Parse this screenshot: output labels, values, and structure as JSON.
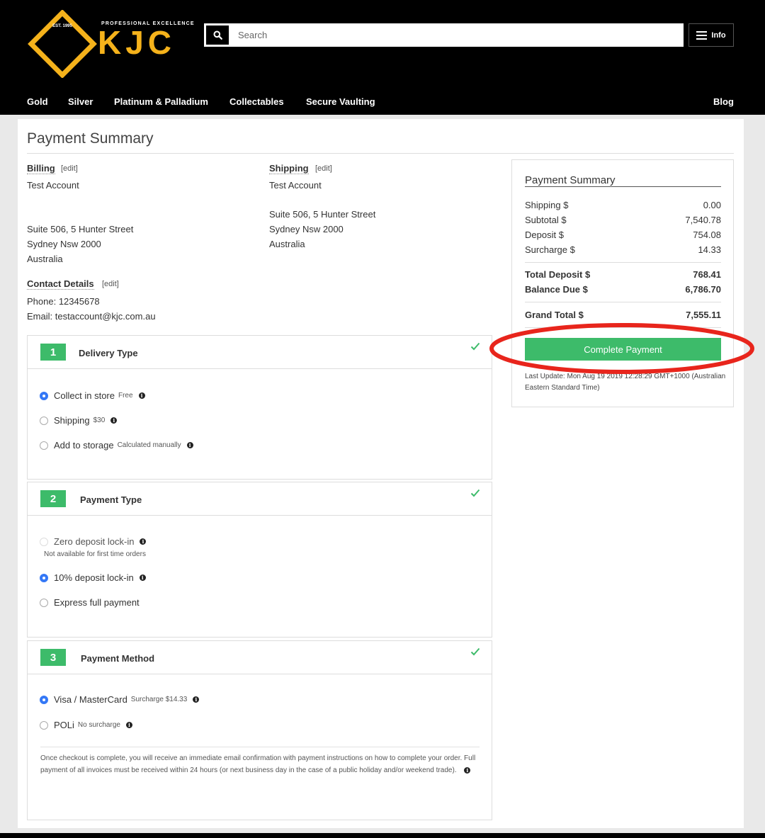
{
  "brand": {
    "name": "KJC",
    "tagline": "PROFESSIONAL EXCELLENCE",
    "est": "EST. 1995",
    "accent_color": "#f5b21b"
  },
  "search": {
    "placeholder": "Search"
  },
  "info_button": {
    "label": "Info"
  },
  "nav": {
    "items": [
      "Gold",
      "Silver",
      "Platinum & Palladium",
      "Collectables",
      "Secure Vaulting"
    ],
    "right_item": "Blog"
  },
  "page_title": "Payment Summary",
  "billing": {
    "label": "Billing",
    "edit": "[edit]",
    "name": "Test Account",
    "address1": "Suite 506, 5 Hunter Street",
    "address2": "Sydney Nsw 2000",
    "country": "Australia"
  },
  "shipping": {
    "label": "Shipping",
    "edit": "[edit]",
    "name": "Test Account",
    "address1": "Suite 506, 5 Hunter Street",
    "address2": "Sydney Nsw 2000",
    "country": "Australia"
  },
  "contact": {
    "label": "Contact Details",
    "edit": "[edit]",
    "phone": "Phone: 12345678",
    "email": "Email: testaccount@kjc.com.au"
  },
  "steps": {
    "delivery": {
      "number": "1",
      "title": "Delivery Type",
      "options": [
        {
          "label": "Collect in store",
          "note": "Free",
          "selected": true
        },
        {
          "label": "Shipping",
          "note": "$30",
          "selected": false
        },
        {
          "label": "Add to storage",
          "note": "Calculated manually",
          "selected": false
        }
      ]
    },
    "payment_type": {
      "number": "2",
      "title": "Payment Type",
      "options": [
        {
          "label": "Zero deposit lock-in",
          "sub": "Not available for first time orders",
          "selected": false,
          "disabled": true
        },
        {
          "label": "10% deposit lock-in",
          "selected": true
        },
        {
          "label": "Express full payment",
          "selected": false
        }
      ]
    },
    "payment_method": {
      "number": "3",
      "title": "Payment Method",
      "options": [
        {
          "label": "Visa / MasterCard",
          "note": "Surcharge $14.33",
          "selected": true
        },
        {
          "label": "POLi",
          "note": "No surcharge",
          "selected": false
        }
      ],
      "fine_print": "Once checkout is complete, you will receive an immediate email confirmation with payment instructions on how to complete your order. Full payment of all invoices must be received within 24 hours (or next business day in the case of a public holiday and/or weekend trade)."
    }
  },
  "summary": {
    "title": "Payment Summary",
    "rows": [
      {
        "label": "Shipping $",
        "value": "0.00"
      },
      {
        "label": "Subtotal $",
        "value": "7,540.78"
      },
      {
        "label": "Deposit $",
        "value": "754.08"
      },
      {
        "label": "Surcharge $",
        "value": "14.33"
      }
    ],
    "totals": [
      {
        "label": "Total Deposit $",
        "value": "768.41"
      },
      {
        "label": "Balance Due $",
        "value": "6,786.70"
      }
    ],
    "grand_total": {
      "label": "Grand Total $",
      "value": "7,555.11"
    },
    "button": "Complete Payment",
    "last_update": "Last Update: Mon Aug 19 2019 12:28:29 GMT+1000 (Australian Eastern Standard Time)",
    "button_color": "#3dbb6a",
    "highlight_color": "#e8251c"
  }
}
